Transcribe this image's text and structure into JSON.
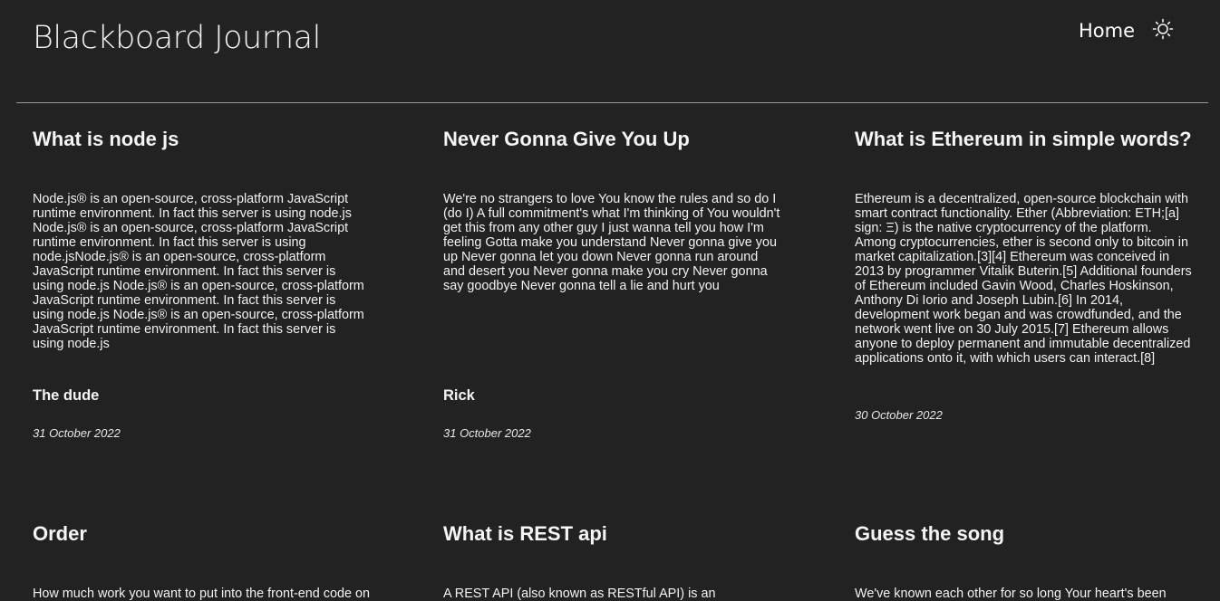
{
  "header": {
    "brand": "Blackboard Journal",
    "nav_home": "Home",
    "theme_icon": "sun-icon"
  },
  "posts": [
    {
      "title": "What is node js",
      "body": "Node.js® is an open-source, cross-platform JavaScript runtime environment. In fact this server is using node.js Node.js® is an open-source, cross-platform JavaScript runtime environment. In fact this server is using node.jsNode.js® is an open-source, cross-platform JavaScript runtime environment. In fact this server is using node.js Node.js® is an open-source, cross-platform JavaScript runtime environment. In fact this server is using node.js Node.js® is an open-source, cross-platform JavaScript runtime environment. In fact this server is using node.js",
      "author": "The dude",
      "date": "31 October 2022"
    },
    {
      "title": "Never Gonna Give You Up",
      "body": "We're no strangers to love You know the rules and so do I (do I) A full commitment's what I'm thinking of You wouldn't get this from any other guy I just wanna tell you how I'm feeling Gotta make you understand Never gonna give you up Never gonna let you down Never gonna run around and desert you Never gonna make you cry Never gonna say goodbye Never gonna tell a lie and hurt you",
      "author": "Rick",
      "date": "31 October 2022"
    },
    {
      "title": "What is Ethereum in simple words?",
      "body": "Ethereum is a decentralized, open-source blockchain with smart contract functionality. Ether (Abbreviation: ETH;[a] sign: Ξ) is the native cryptocurrency of the platform. Among cryptocurrencies, ether is second only to bitcoin in market capitalization.[3][4] Ethereum was conceived in 2013 by programmer Vitalik Buterin.[5] Additional founders of Ethereum included Gavin Wood, Charles Hoskinson, Anthony Di Iorio and Joseph Lubin.[6] In 2014, development work began and was crowdfunded, and the network went live on 30 July 2015.[7] Ethereum allows anyone to deploy permanent and immutable decentralized applications onto it, with which users can interact.[8]",
      "author": "",
      "date": "30 October 2022"
    },
    {
      "title": "Order",
      "body": "How much work you want to put into the front-end code on"
    },
    {
      "title": "What is REST api",
      "body": "A REST API (also known as RESTful API) is an"
    },
    {
      "title": "Guess the song",
      "body": "We've known each other for so long Your heart's been"
    }
  ]
}
